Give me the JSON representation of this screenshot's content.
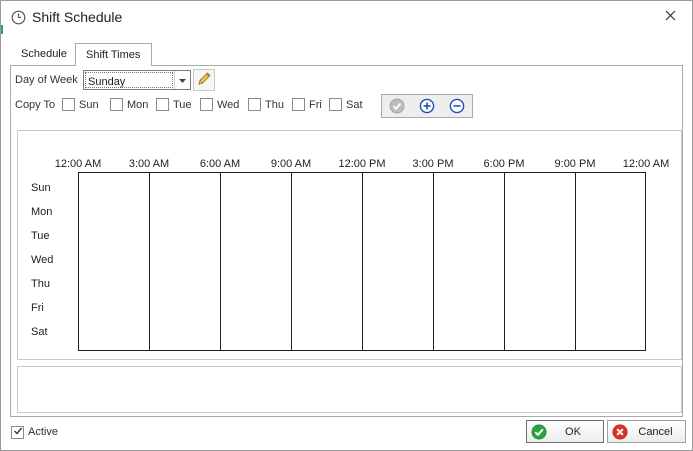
{
  "window": {
    "title": "Shift Schedule",
    "icon": "clock-icon"
  },
  "tabs": [
    {
      "label": "Schedule",
      "active": false
    },
    {
      "label": "Shift Times",
      "active": true
    }
  ],
  "day_of_week": {
    "label": "Day of Week",
    "value": "Sunday"
  },
  "copy_to": {
    "label": "Copy To",
    "days": [
      {
        "label": "Sun",
        "checked": false
      },
      {
        "label": "Mon",
        "checked": false
      },
      {
        "label": "Tue",
        "checked": false
      },
      {
        "label": "Wed",
        "checked": false
      },
      {
        "label": "Thu",
        "checked": false
      },
      {
        "label": "Fri",
        "checked": false
      },
      {
        "label": "Sat",
        "checked": false
      }
    ]
  },
  "toolbar": {
    "icons": [
      "apply-check-icon",
      "add-icon",
      "remove-icon"
    ]
  },
  "schedule": {
    "times": [
      "12:00 AM",
      "3:00 AM",
      "6:00 AM",
      "9:00 AM",
      "12:00 PM",
      "3:00 PM",
      "6:00 PM",
      "9:00 PM",
      "12:00 AM"
    ],
    "days": [
      "Sun",
      "Mon",
      "Tue",
      "Wed",
      "Thu",
      "Fri",
      "Sat"
    ]
  },
  "footer": {
    "active_label": "Active",
    "active_checked": true,
    "ok_label": "OK",
    "cancel_label": "Cancel"
  },
  "colors": {
    "ok_green": "#2aa43a",
    "cancel_red": "#d9322b",
    "toolbar_blue": "#1f4fb5"
  }
}
